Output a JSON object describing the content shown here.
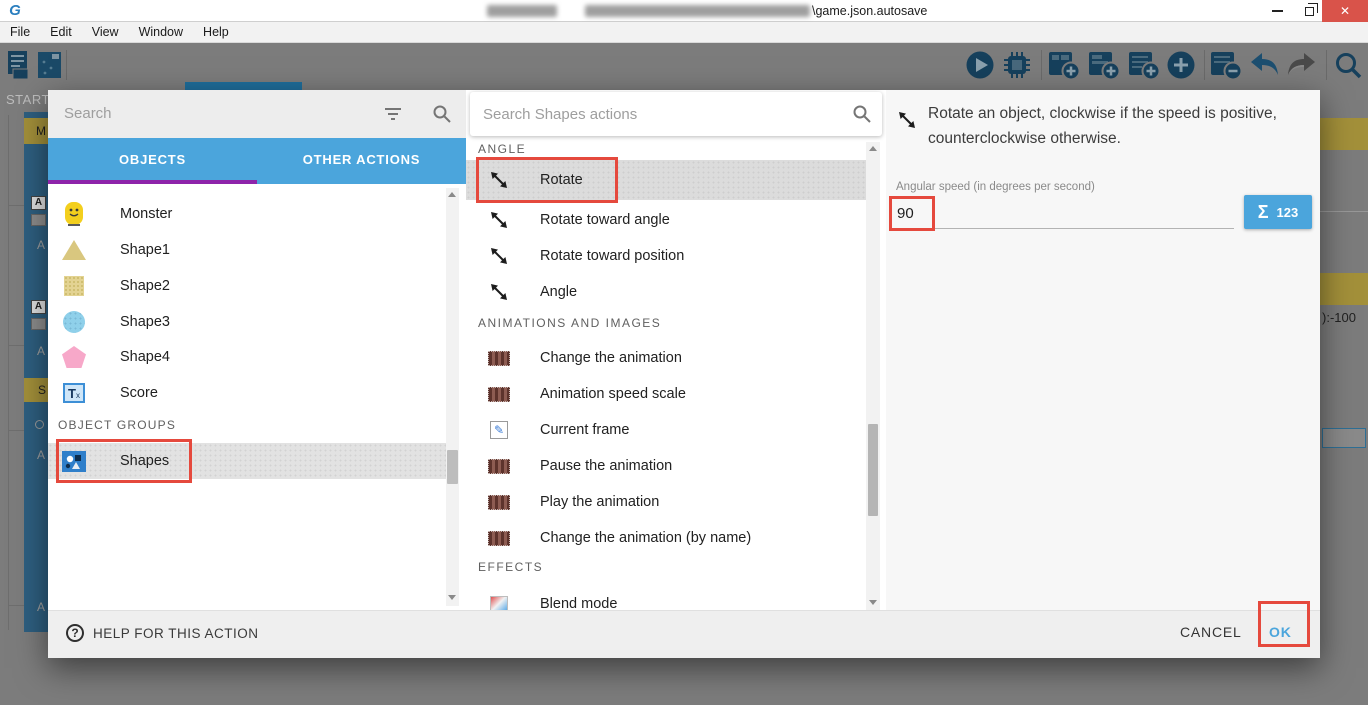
{
  "window": {
    "title_fragment": "\\game.json.autosave"
  },
  "menu": {
    "items": [
      "File",
      "Edit",
      "View",
      "Window",
      "Help"
    ]
  },
  "toolbar": {
    "left_icons": [
      "project-manager-icon",
      "scene-editor-icon"
    ],
    "right_icons": [
      "play-icon",
      "debug-icon",
      "add-sub-event-icon",
      "add-event-icon",
      "add-comment-icon",
      "add-circle-icon",
      "delete-event-icon",
      "undo-icon",
      "redo-icon",
      "search-icon"
    ]
  },
  "background": {
    "events_tab": "START",
    "fragment_m": "M",
    "fragment_s": "S",
    "fragment_a": "A",
    "right_expression": "):-100"
  },
  "dialog": {
    "left": {
      "search_placeholder": "Search",
      "tab_objects": "OBJECTS",
      "tab_other": "OTHER ACTIONS",
      "objects": [
        {
          "name": "Monster",
          "icon": "monster-icon"
        },
        {
          "name": "Shape1",
          "icon": "triangle-icon"
        },
        {
          "name": "Shape2",
          "icon": "square-icon"
        },
        {
          "name": "Shape3",
          "icon": "circle-icon"
        },
        {
          "name": "Shape4",
          "icon": "pentagon-icon"
        },
        {
          "name": "Score",
          "icon": "text-object-icon"
        }
      ],
      "groups_header": "OBJECT GROUPS",
      "groups": [
        {
          "name": "Shapes",
          "icon": "object-group-icon",
          "selected": true
        }
      ]
    },
    "middle": {
      "search_placeholder": "Search Shapes actions",
      "sections": [
        {
          "header": "ANGLE",
          "items": [
            "Rotate",
            "Rotate toward angle",
            "Rotate toward position",
            "Angle"
          ]
        },
        {
          "header": "ANIMATIONS AND IMAGES",
          "items": [
            "Change the animation",
            "Animation speed scale",
            "Current frame",
            "Pause the animation",
            "Play the animation",
            "Change the animation (by name)"
          ]
        },
        {
          "header": "EFFECTS",
          "items": [
            "Blend mode"
          ]
        }
      ],
      "selected_action": "Rotate"
    },
    "right": {
      "description": "Rotate an object, clockwise if the speed is positive, counterclockwise otherwise.",
      "param_label": "Angular speed (in degrees per second)",
      "param_value": "90",
      "expression_sigma": "Σ",
      "expression_123": "123"
    },
    "footer": {
      "help": "HELP FOR THIS ACTION",
      "cancel": "CANCEL",
      "ok": "OK"
    }
  },
  "colors": {
    "accent_blue": "#4ba5dc",
    "tab_underline_purple": "#8e24aa",
    "annotation_red": "#e5493d",
    "close_button_red": "#d9534a",
    "selection_gray": "#dcdcdc"
  }
}
